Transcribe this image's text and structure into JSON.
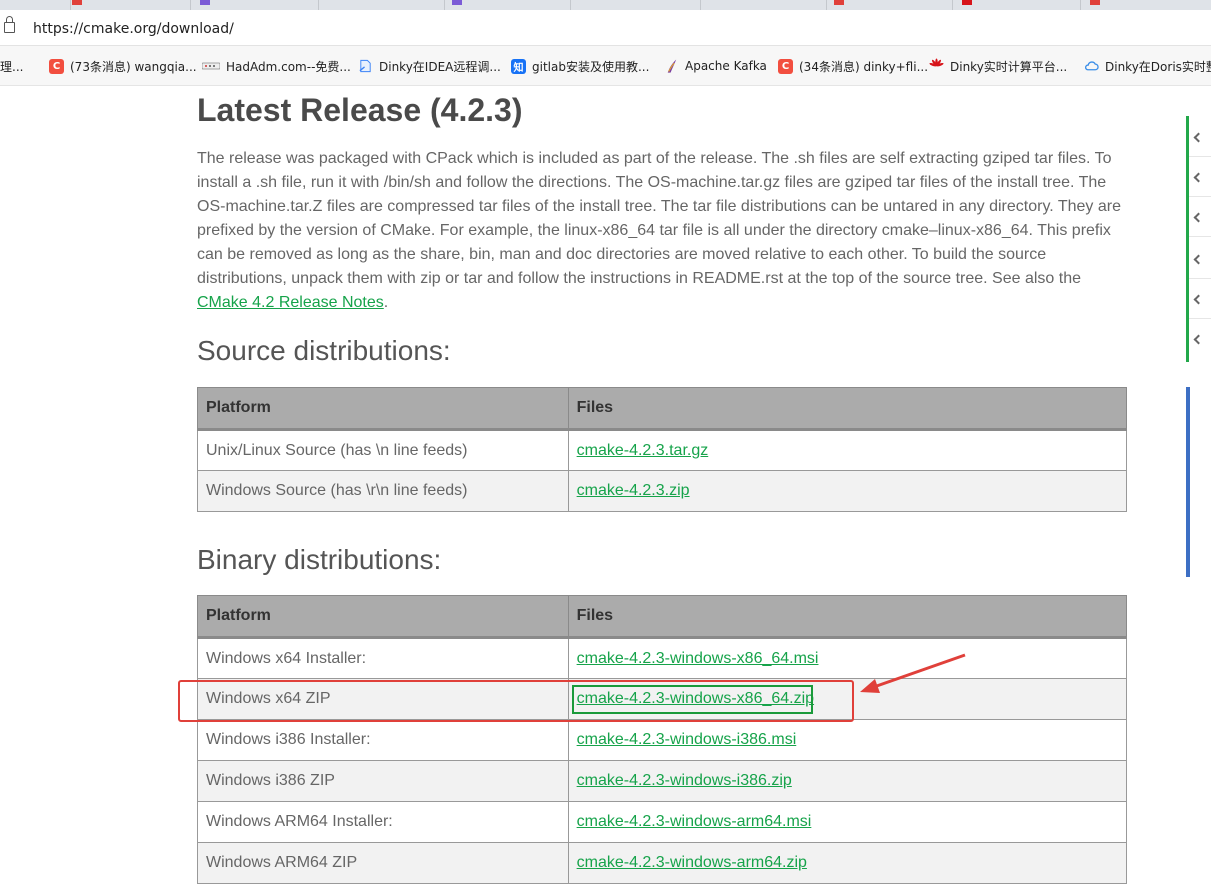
{
  "browser": {
    "url": "https://cmake.org/download/",
    "bookmarks": [
      {
        "label": "理...",
        "icon": "text-icon",
        "color": ""
      },
      {
        "label": "(73条消息) wangqia...",
        "icon": "csdn-icon",
        "color": "#f24e3f"
      },
      {
        "label": "HadAdm.com--免费...",
        "icon": "hadadm-icon",
        "color": "#999999"
      },
      {
        "label": "Dinky在IDEA远程调...",
        "icon": "page-icon",
        "color": "#3b82f6"
      },
      {
        "label": "gitlab安装及使用教...",
        "icon": "zhihu-icon",
        "color": "#1772f6"
      },
      {
        "label": "Apache Kafka",
        "icon": "kafka-icon",
        "color": "#7b3fa0"
      },
      {
        "label": "(34条消息) dinky+fli...",
        "icon": "csdn-icon",
        "color": "#f24e3f"
      },
      {
        "label": "Dinky实时计算平台...",
        "icon": "huawei-icon",
        "color": "#d7141a"
      },
      {
        "label": "Dinky在Doris实时整",
        "icon": "cloud-icon",
        "color": "#3b8ee8"
      }
    ],
    "bookmark_glyphs": {
      "csdn": "C",
      "zhihu": "知"
    }
  },
  "release": {
    "title": "Latest Release (4.2.3)",
    "paragraph": "The release was packaged with CPack which is included as part of the release. The .sh files are self extracting gziped tar files. To install a .sh file, run it with /bin/sh and follow the directions. The OS-machine.tar.gz files are gziped tar files of the install tree. The OS-machine.tar.Z files are compressed tar files of the install tree. The tar file distributions can be untared in any directory. They are prefixed by the version of CMake. For example, the linux-x86_64 tar file is all under the directory cmake–linux-x86_64. This prefix can be removed as long as the share, bin, man and doc directories are moved relative to each other. To build the source distributions, unpack them with zip or tar and follow the instructions in README.rst at the top of the source tree. See also the ",
    "link_text": "CMake 4.2 Release Notes",
    "trailing": "."
  },
  "source": {
    "heading": "Source distributions:",
    "col_platform": "Platform",
    "col_files": "Files",
    "rows": [
      {
        "platform": "Unix/Linux Source (has \\n line feeds)",
        "file": "cmake-4.2.3.tar.gz"
      },
      {
        "platform": "Windows Source (has \\r\\n line feeds)",
        "file": "cmake-4.2.3.zip"
      }
    ]
  },
  "binary": {
    "heading": "Binary distributions:",
    "col_platform": "Platform",
    "col_files": "Files",
    "rows": [
      {
        "platform": "Windows x64 Installer:",
        "file": "cmake-4.2.3-windows-x86_64.msi"
      },
      {
        "platform": "Windows x64 ZIP",
        "file": "cmake-4.2.3-windows-x86_64.zip"
      },
      {
        "platform": "Windows i386 Installer:",
        "file": "cmake-4.2.3-windows-i386.msi"
      },
      {
        "platform": "Windows i386 ZIP",
        "file": "cmake-4.2.3-windows-i386.zip"
      },
      {
        "platform": "Windows ARM64 Installer:",
        "file": "cmake-4.2.3-windows-arm64.msi"
      },
      {
        "platform": "Windows ARM64 ZIP",
        "file": "cmake-4.2.3-windows-arm64.zip"
      }
    ]
  },
  "colors": {
    "link": "#16a34a",
    "annotation_red": "#e0403a",
    "annotation_green": "#1a9a3a",
    "toc_accent": "#22a84a",
    "panel_accent": "#3d6fc4"
  }
}
